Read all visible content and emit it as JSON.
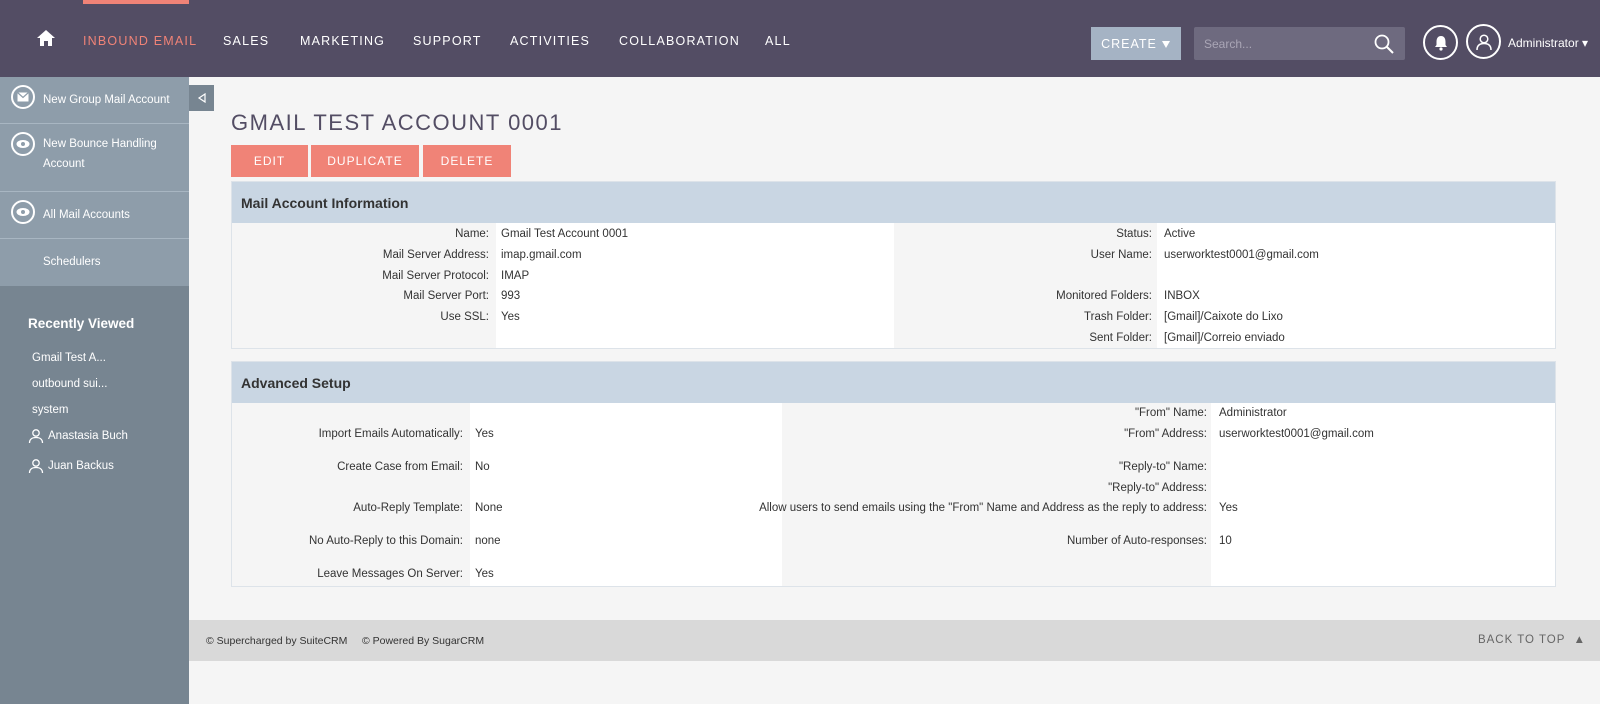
{
  "nav": {
    "items": [
      "INBOUND EMAIL",
      "SALES",
      "MARKETING",
      "SUPPORT",
      "ACTIVITIES",
      "COLLABORATION",
      "ALL"
    ],
    "create_label": "CREATE",
    "search_placeholder": "Search...",
    "user_label": "Administrator",
    "accent_color": "#f08377",
    "bar_color": "#534d64"
  },
  "sidebar": {
    "actions": [
      {
        "label": "New Group Mail Account",
        "icon": "mail-icon"
      },
      {
        "label": "New Bounce Handling Account",
        "icon": "eye-icon"
      },
      {
        "label": "All Mail Accounts",
        "icon": "eye-icon"
      },
      {
        "label": "Schedulers",
        "icon": ""
      }
    ],
    "recently_viewed_title": "Recently Viewed",
    "recently_viewed": [
      {
        "label": "Gmail Test A...",
        "icon": ""
      },
      {
        "label": "outbound sui...",
        "icon": ""
      },
      {
        "label": "system",
        "icon": ""
      },
      {
        "label": "Anastasia Buch",
        "icon": "user-icon"
      },
      {
        "label": "Juan Backus",
        "icon": "user-icon"
      }
    ]
  },
  "main": {
    "title": "GMAIL TEST ACCOUNT 0001",
    "buttons": {
      "edit": "EDIT",
      "duplicate": "DUPLICATE",
      "delete": "DELETE"
    },
    "mail_account": {
      "header": "Mail Account Information",
      "left": [
        {
          "label": "Name:",
          "value": "Gmail Test Account 0001"
        },
        {
          "label": "Mail Server Address:",
          "value": "imap.gmail.com"
        },
        {
          "label": "Mail Server Protocol:",
          "value": "IMAP"
        },
        {
          "label": "Mail Server Port:",
          "value": "993"
        },
        {
          "label": "Use SSL:",
          "value": "Yes"
        }
      ],
      "right": [
        {
          "label": "Status:",
          "value": "Active"
        },
        {
          "label": "User Name:",
          "value": "userworktest0001@gmail.com"
        },
        {
          "label": "",
          "value": ""
        },
        {
          "label": "Monitored Folders:",
          "value": "INBOX"
        },
        {
          "label": "Trash Folder:",
          "value": "[Gmail]/Caixote do Lixo"
        },
        {
          "label": "Sent Folder:",
          "value": "[Gmail]/Correio enviado"
        }
      ]
    },
    "advanced": {
      "header": "Advanced Setup",
      "left": [
        {
          "label": "Import Emails Automatically:",
          "value": "Yes"
        },
        {
          "label": "Create Case from Email:",
          "value": "No"
        },
        {
          "label": "Auto-Reply Template:",
          "value": "None"
        },
        {
          "label": "No Auto-Reply to this Domain:",
          "value": "none"
        },
        {
          "label": "Leave Messages On Server:",
          "value": "Yes"
        }
      ],
      "right": [
        {
          "label": "\"From\" Name:",
          "value": "Administrator"
        },
        {
          "label": "\"From\" Address:",
          "value": "userworktest0001@gmail.com"
        },
        {
          "label": "\"Reply-to\" Name:",
          "value": ""
        },
        {
          "label": "\"Reply-to\" Address:",
          "value": ""
        },
        {
          "label": "Allow users to send emails using the \"From\" Name and Address as the reply to address:",
          "value": "Yes"
        },
        {
          "label": "Number of Auto-responses:",
          "value": "10"
        }
      ]
    }
  },
  "footer": {
    "left": "© Supercharged by SuiteCRM     © Powered By SugarCRM",
    "back_to_top": "BACK TO TOP  ▲"
  }
}
